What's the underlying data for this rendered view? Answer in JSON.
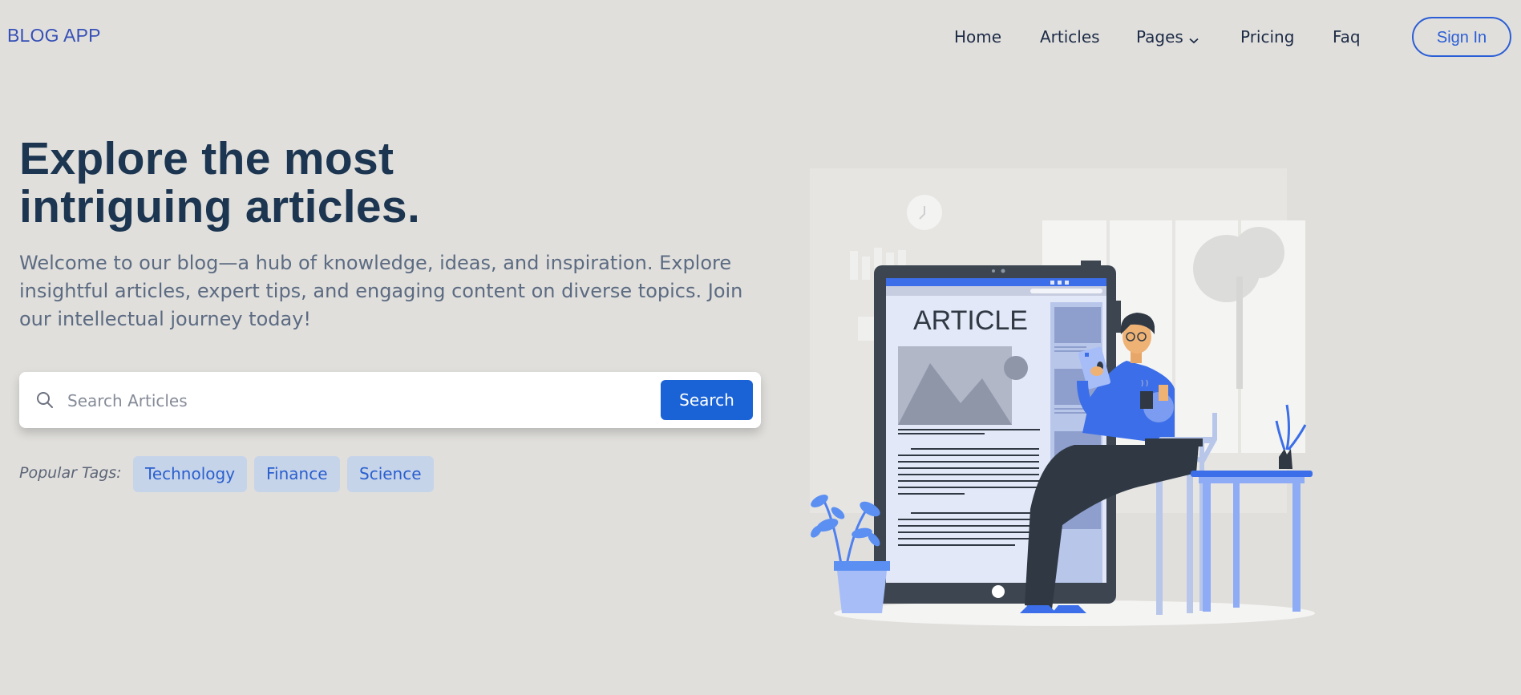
{
  "nav": {
    "brand": "BLOG APP",
    "items": [
      {
        "label": "Home"
      },
      {
        "label": "Articles"
      },
      {
        "label": "Pages"
      },
      {
        "label": "Pricing"
      },
      {
        "label": "Faq"
      }
    ],
    "signin_label": "Sign In"
  },
  "hero": {
    "title_line1": "Explore the most",
    "title_line2": "intriguing articles.",
    "subtitle": "Welcome to our blog—a hub of knowledge, ideas, and inspiration. Explore insightful articles, expert tips, and engaging content on diverse topics. Join our intellectual journey today!"
  },
  "search": {
    "placeholder": "Search Articles",
    "button_label": "Search"
  },
  "tags": {
    "label": "Popular Tags:",
    "items": [
      "Technology",
      "Finance",
      "Science"
    ]
  },
  "illustration": {
    "heading": "ARTICLE"
  },
  "colors": {
    "background": "#e0dfdc",
    "brand": "#3650b7",
    "accent": "#1a63d6",
    "title": "#1c3550",
    "tag_bg": "#c6d4ea"
  }
}
